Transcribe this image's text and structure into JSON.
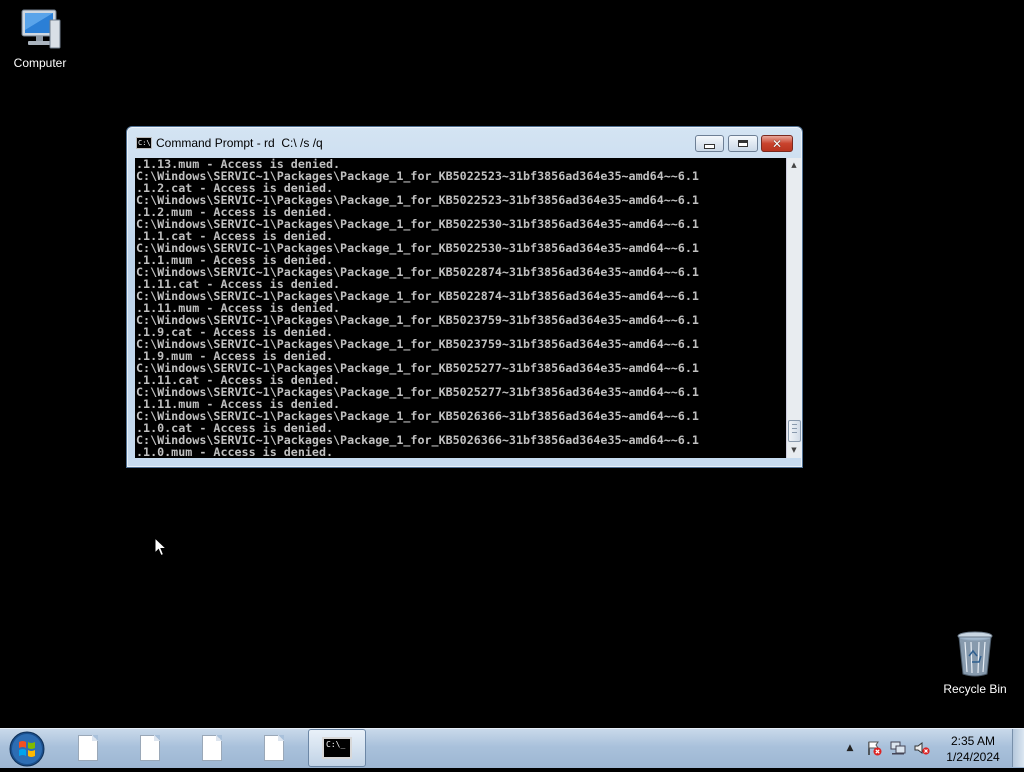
{
  "desktop": {
    "icons": [
      {
        "label": "Computer",
        "icon": "computer-icon"
      },
      {
        "label": "Recycle Bin",
        "icon": "recycle-bin-icon"
      }
    ]
  },
  "window": {
    "title": "Command Prompt - rd  C:\\ /s /q",
    "buttons": {
      "minimize": "minimize",
      "maximize": "maximize",
      "close": "close"
    },
    "console_lines": [
      ".1.13.mum - Access is denied.",
      "C:\\Windows\\SERVIC~1\\Packages\\Package_1_for_KB5022523~31bf3856ad364e35~amd64~~6.1",
      ".1.2.cat - Access is denied.",
      "C:\\Windows\\SERVIC~1\\Packages\\Package_1_for_KB5022523~31bf3856ad364e35~amd64~~6.1",
      ".1.2.mum - Access is denied.",
      "C:\\Windows\\SERVIC~1\\Packages\\Package_1_for_KB5022530~31bf3856ad364e35~amd64~~6.1",
      ".1.1.cat - Access is denied.",
      "C:\\Windows\\SERVIC~1\\Packages\\Package_1_for_KB5022530~31bf3856ad364e35~amd64~~6.1",
      ".1.1.mum - Access is denied.",
      "C:\\Windows\\SERVIC~1\\Packages\\Package_1_for_KB5022874~31bf3856ad364e35~amd64~~6.1",
      ".1.11.cat - Access is denied.",
      "C:\\Windows\\SERVIC~1\\Packages\\Package_1_for_KB5022874~31bf3856ad364e35~amd64~~6.1",
      ".1.11.mum - Access is denied.",
      "C:\\Windows\\SERVIC~1\\Packages\\Package_1_for_KB5023759~31bf3856ad364e35~amd64~~6.1",
      ".1.9.cat - Access is denied.",
      "C:\\Windows\\SERVIC~1\\Packages\\Package_1_for_KB5023759~31bf3856ad364e35~amd64~~6.1",
      ".1.9.mum - Access is denied.",
      "C:\\Windows\\SERVIC~1\\Packages\\Package_1_for_KB5025277~31bf3856ad364e35~amd64~~6.1",
      ".1.11.cat - Access is denied.",
      "C:\\Windows\\SERVIC~1\\Packages\\Package_1_for_KB5025277~31bf3856ad364e35~amd64~~6.1",
      ".1.11.mum - Access is denied.",
      "C:\\Windows\\SERVIC~1\\Packages\\Package_1_for_KB5026366~31bf3856ad364e35~amd64~~6.1",
      ".1.0.cat - Access is denied.",
      "C:\\Windows\\SERVIC~1\\Packages\\Package_1_for_KB5026366~31bf3856ad364e35~amd64~~6.1",
      ".1.0.mum - Access is denied."
    ]
  },
  "taskbar": {
    "start_icon": "windows-start-icon",
    "pinned": [
      {
        "icon": "document-icon"
      },
      {
        "icon": "document-icon"
      },
      {
        "icon": "document-icon"
      },
      {
        "icon": "document-icon"
      },
      {
        "icon": "command-prompt-icon",
        "active": true
      }
    ],
    "tray": {
      "icons": [
        "show-hidden-icons-arrow",
        "action-center-flag-icon",
        "network-icon",
        "volume-muted-icon"
      ],
      "time": "2:35 AM",
      "date": "1/24/2024"
    }
  },
  "colors": {
    "console_text": "#c0c0c0",
    "console_bg": "#000000",
    "desktop_bg": "#000000",
    "taskbar": "#a9c1db"
  }
}
